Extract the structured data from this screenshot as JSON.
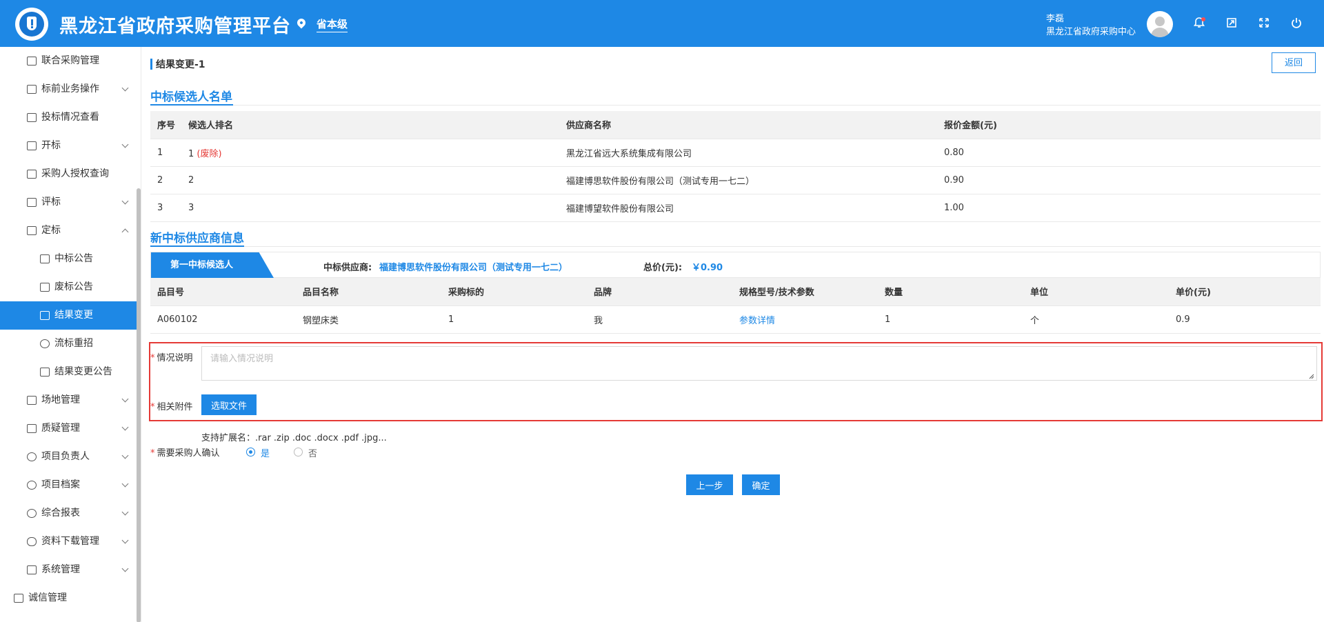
{
  "header": {
    "app_title": "黑龙江省政府采购管理平台",
    "region": "省本级",
    "user_name": "李磊",
    "user_org": "黑龙江省政府采购中心"
  },
  "sidebar": {
    "items": [
      {
        "label": "联合采购管理"
      },
      {
        "label": "标前业务操作"
      },
      {
        "label": "投标情况查看"
      },
      {
        "label": "开标"
      },
      {
        "label": "采购人授权查询"
      },
      {
        "label": "评标"
      },
      {
        "label": "定标"
      },
      {
        "label": "中标公告"
      },
      {
        "label": "废标公告"
      },
      {
        "label": "结果变更"
      },
      {
        "label": "流标重招"
      },
      {
        "label": "结果变更公告"
      },
      {
        "label": "场地管理"
      },
      {
        "label": "质疑管理"
      },
      {
        "label": "项目负责人"
      },
      {
        "label": "项目档案"
      },
      {
        "label": "综合报表"
      },
      {
        "label": "资料下载管理"
      },
      {
        "label": "系统管理"
      },
      {
        "label": "诚信管理"
      }
    ]
  },
  "page": {
    "title": "结果变更-1",
    "back_label": "返回"
  },
  "candidates": {
    "section_title": "中标候选人名单",
    "headers": [
      "序号",
      "候选人排名",
      "供应商名称",
      "报价金额(元)"
    ],
    "rows": [
      {
        "no": "1",
        "rank": "1",
        "tag": "(废除)",
        "supplier": "黑龙江省远大系统集成有限公司",
        "amount": "0.80"
      },
      {
        "no": "2",
        "rank": "2",
        "tag": "",
        "supplier": "福建博思软件股份有限公司（测试专用一七二）",
        "amount": "0.90"
      },
      {
        "no": "3",
        "rank": "3",
        "tag": "",
        "supplier": "福建博望软件股份有限公司",
        "amount": "1.00"
      }
    ]
  },
  "new_winner": {
    "section_title": "新中标供应商信息",
    "tab_label": "第一中标候选人",
    "supplier_label": "中标供应商:",
    "supplier_value": "福建博思软件股份有限公司（测试专用一七二）",
    "total_label": "总价(元):",
    "total_value": "￥0.90",
    "headers": [
      "品目号",
      "品目名称",
      "采购标的",
      "品牌",
      "规格型号/技术参数",
      "数量",
      "单位",
      "单价(元)"
    ],
    "rows": [
      {
        "code": "A060102",
        "name": "钢塑床类",
        "target": "1",
        "brand": "我",
        "spec": "参数详情",
        "qty": "1",
        "unit": "个",
        "price": "0.9"
      }
    ]
  },
  "form": {
    "desc_label": "情况说明",
    "desc_placeholder": "请输入情况说明",
    "attach_label": "相关附件",
    "choose_file": "选取文件",
    "ext_hint": "支持扩展名：.rar .zip .doc .docx .pdf .jpg...",
    "confirm_label": "需要采购人确认",
    "option_yes": "是",
    "option_no": "否",
    "prev_button": "上一步",
    "ok_button": "确定"
  },
  "colors": {
    "primary": "#1e88e5",
    "danger": "#e53935"
  }
}
